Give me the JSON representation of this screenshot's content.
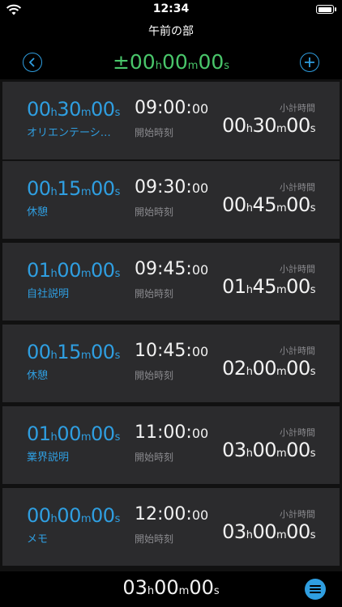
{
  "status": {
    "time": "12:34"
  },
  "title": "午前の部",
  "header": {
    "timer": {
      "sign": "±",
      "h": "00",
      "h_unit": "h",
      "m": "00",
      "m_unit": "m",
      "s": "00",
      "s_unit": "s"
    }
  },
  "common": {
    "start_label": "開始時刻",
    "subtotal_label": "小計時間"
  },
  "items": [
    {
      "dur_h": "00",
      "dur_m": "30",
      "dur_s": "00",
      "label": "オリエンテーション",
      "start": "09:00",
      "start_sec": "00",
      "sub_h": "00",
      "sub_m": "30",
      "sub_s": "00"
    },
    {
      "dur_h": "00",
      "dur_m": "15",
      "dur_s": "00",
      "label": "休憩",
      "start": "09:30",
      "start_sec": "00",
      "sub_h": "00",
      "sub_m": "45",
      "sub_s": "00"
    },
    {
      "dur_h": "01",
      "dur_m": "00",
      "dur_s": "00",
      "label": "自社説明",
      "start": "09:45",
      "start_sec": "00",
      "sub_h": "01",
      "sub_m": "45",
      "sub_s": "00"
    },
    {
      "dur_h": "00",
      "dur_m": "15",
      "dur_s": "00",
      "label": "休憩",
      "start": "10:45",
      "start_sec": "00",
      "sub_h": "02",
      "sub_m": "00",
      "sub_s": "00"
    },
    {
      "dur_h": "01",
      "dur_m": "00",
      "dur_s": "00",
      "label": "業界説明",
      "start": "11:00",
      "start_sec": "00",
      "sub_h": "03",
      "sub_m": "00",
      "sub_s": "00"
    },
    {
      "dur_h": "00",
      "dur_m": "00",
      "dur_s": "00",
      "label": "メモ",
      "start": "12:00",
      "start_sec": "00",
      "sub_h": "03",
      "sub_m": "00",
      "sub_s": "00"
    }
  ],
  "footer": {
    "total_h": "03",
    "total_m": "00",
    "total_s": "00"
  },
  "units": {
    "h": "h",
    "m": "m",
    "s": "s"
  },
  "colors": {
    "accent": "#2f9ee0",
    "timer": "#49c56a",
    "card": "#2b2b2d"
  },
  "icons": {
    "back": "chevron-left-circle-icon",
    "add": "plus-circle-icon",
    "menu": "menu-icon"
  }
}
